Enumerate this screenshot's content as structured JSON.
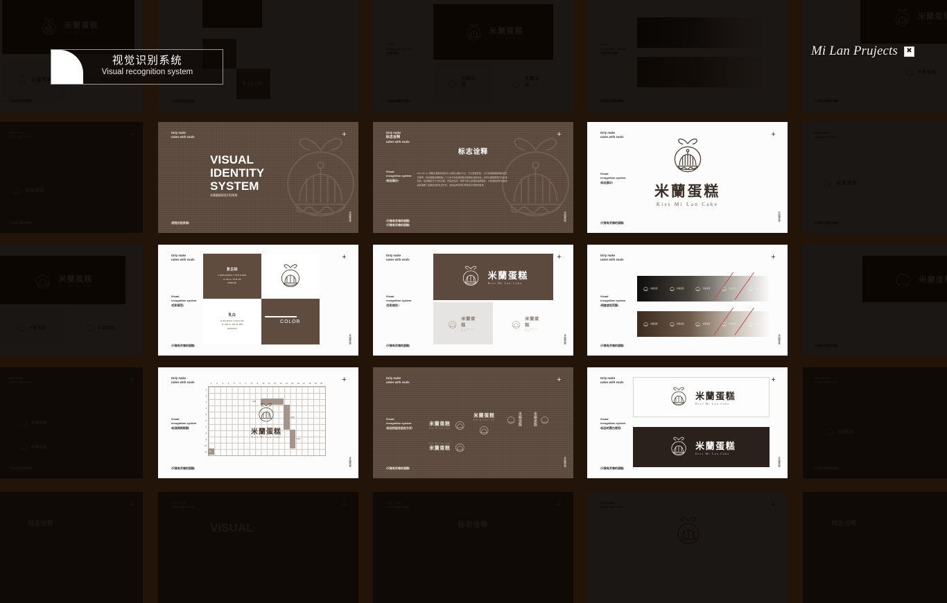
{
  "window": {
    "title": "Mi Lan Prujects",
    "close_icon": "broken-image-icon",
    "close_glyph": "✖"
  },
  "overlay_badge": {
    "title_cn": "视觉识别系统",
    "title_en": "Visual recognition system"
  },
  "brand": {
    "name_cn": "米蘭蛋糕",
    "name_en": "Kiss Mi Lan Cake",
    "tagline_l1": "Only make",
    "tagline_l2": "cakes with souls",
    "footer": "/只做有灵魂的蛋糕/",
    "plus_glyph": "+",
    "vrs_l1": "Visual",
    "vrs_l2": "recognition system"
  },
  "colors": {
    "page_bg": "#231409",
    "brand_brown": "#604C3F",
    "brand_cream": "#FFFFFF",
    "slide_white": "#FCFCFC",
    "badge_border": "#9B9B9B"
  },
  "slides": {
    "cover": {
      "title_l1": "VISUAL",
      "title_l2": "IDENTITY",
      "title_l3": "SYSTEM",
      "subtitle": "米蘭蛋糕视觉识别系统",
      "section": "/视觉识别系统/"
    },
    "logo_meaning": {
      "title": "标志诠释",
      "section": "/标志展示/",
      "body": "Kiss Mi Lan 用糕点温润的质感令人感知大量的与之、于礼造物形象、人们对蛋糕甜美味的记忆与味蕾、将这温暖的甜味融入了心中与本色温润着对幸福生活的向往。标志以蛋糕造型作为主体形象、结合樱桃与叶片的点缀、传递出自然、纯粹与用心烘焙的品牌理念、以简洁的线条勾勒出品牌温暖了品牌最初的生活方式、这也是未来我们持续设计思想的追求。"
    },
    "logo_display": {
      "section": "/标志展示/"
    },
    "color_spec": {
      "section": "/色彩规范/",
      "swatch1_name": "复古棕",
      "swatch1_cmyk": "C:65% M:68% Y:74% K:26%",
      "swatch1_rgb": "R: 96  G: 76  B: 63",
      "swatch1_hex": "#604C3F",
      "swatch2_name": "乳白",
      "swatch2_cmyk": "C:0% M:0% Y:0% K:0%",
      "swatch2_rgb": "R: 255  G: 255  B: 255",
      "swatch2_hex": "#FFFFFF",
      "color_label": "COLOR"
    },
    "color_usage": {
      "section": "/色彩使用 /"
    },
    "gradient_range": {
      "section": "/明度使用范围/"
    },
    "grid_spec": {
      "section": "/标准网格制图/",
      "columns": [
        "1",
        "2",
        "3",
        "4",
        "5",
        "6",
        "7",
        "8",
        "9",
        "10",
        "11",
        "12",
        "13",
        "14",
        "15",
        "16",
        "17",
        "18",
        "19",
        "20"
      ],
      "rows": [
        "1",
        "2",
        "3",
        "4",
        "5",
        "6",
        "7",
        "8",
        "9",
        "10",
        "11"
      ],
      "measure_a": "3.5X",
      "measure_b": "9.6X",
      "measure_c": "2.6X",
      "unit": "1X"
    },
    "lockups": {
      "section": "/标志的组合组合方式/"
    },
    "backgrounds": {
      "section": "/标志的黑白使用/"
    }
  },
  "ghost_labels": {
    "logo_meaning": "标志诠释",
    "visual": "VISUAL"
  }
}
